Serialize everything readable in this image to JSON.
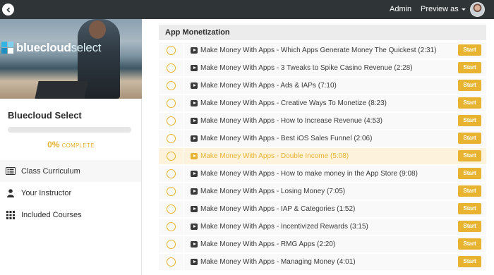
{
  "topbar": {
    "back_icon": "chevron-left-icon",
    "admin_label": "Admin",
    "preview_label": "Preview as",
    "background": "#2f3437"
  },
  "sidebar": {
    "logo": {
      "part1": "bluecloud",
      "part2": "select"
    },
    "course_title": "Bluecloud Select",
    "progress": {
      "percent": 0,
      "percent_label": "0%",
      "complete_label": "COMPLETE"
    },
    "nav": [
      {
        "label": "Class Curriculum",
        "icon": "curriculum-icon",
        "active": true
      },
      {
        "label": "Your Instructor",
        "icon": "user-icon",
        "active": false
      },
      {
        "label": "Included Courses",
        "icon": "grid-icon",
        "active": false
      }
    ]
  },
  "main": {
    "section_title": "App Monetization",
    "start_label": "Start",
    "lectures": [
      {
        "title": "Make Money With Apps - Which Apps Generate Money The Quickest (2:31)",
        "highlight": false
      },
      {
        "title": "Make Money With Apps - 3 Tweaks to Spike Casino Revenue (2:28)",
        "highlight": false
      },
      {
        "title": "Make Money With Apps - Ads & IAPs (7:10)",
        "highlight": false
      },
      {
        "title": "Make Money With Apps - Creative Ways To Monetize (8:23)",
        "highlight": false
      },
      {
        "title": "Make Money With Apps - How to Increase Revenue (4:53)",
        "highlight": false
      },
      {
        "title": "Make Money With Apps - Best iOS Sales Funnel (2:06)",
        "highlight": false
      },
      {
        "title": "Make Money With Apps - Double Income (5:08)",
        "highlight": true
      },
      {
        "title": "Make Money With Apps - How to make money in the App Store (9:08)",
        "highlight": false
      },
      {
        "title": "Make Money With Apps - Losing Money (7:05)",
        "highlight": false
      },
      {
        "title": "Make Money With Apps - IAP & Categories (1:52)",
        "highlight": false
      },
      {
        "title": "Make Money With Apps - Incentivized Rewards (3:15)",
        "highlight": false
      },
      {
        "title": "Make Money With Apps - RMG Apps (2:20)",
        "highlight": false
      },
      {
        "title": "Make Money With Apps - Managing Money (4:01)",
        "highlight": false
      }
    ]
  },
  "colors": {
    "accent": "#e8b330",
    "highlight_row": "#fdf3dc",
    "row": "#f9f9f9"
  }
}
